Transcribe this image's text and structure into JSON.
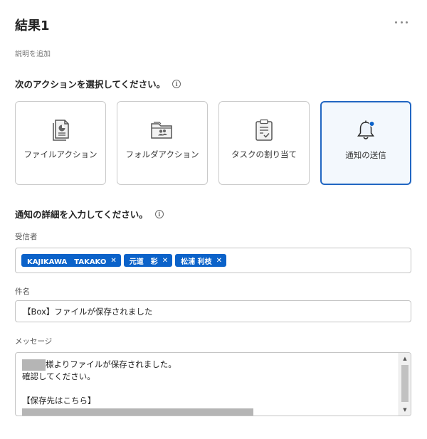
{
  "header": {
    "title": "結果1",
    "add_description": "説明を追加"
  },
  "action_section": {
    "heading": "次のアクションを選択してください。",
    "cards": [
      {
        "label": "ファイルアクション",
        "icon": "file-chart-icon",
        "selected": false
      },
      {
        "label": "フォルダアクション",
        "icon": "folder-users-icon",
        "selected": false
      },
      {
        "label": "タスクの割り当て",
        "icon": "clipboard-check-icon",
        "selected": false
      },
      {
        "label": "通知の送信",
        "icon": "bell-notification-icon",
        "selected": true
      }
    ]
  },
  "detail_section": {
    "heading": "通知の詳細を入力してください。"
  },
  "recipients": {
    "label": "受信者",
    "chips": [
      "KAJIKAWA　TAKAKO",
      "元道　彩",
      "松浦 利枝"
    ]
  },
  "subject": {
    "label": "件名",
    "value": "【Box】ファイルが保存されました"
  },
  "message": {
    "label": "メッセージ",
    "line1": "様よりファイルが保存されました。",
    "line2": "確認してください。",
    "line4": "【保存先はこちら】"
  },
  "colors": {
    "accent": "#0b62c9",
    "selected_border": "#2166c2",
    "selected_bg": "#f3f8fd",
    "redaction": "#b5b5b5"
  }
}
